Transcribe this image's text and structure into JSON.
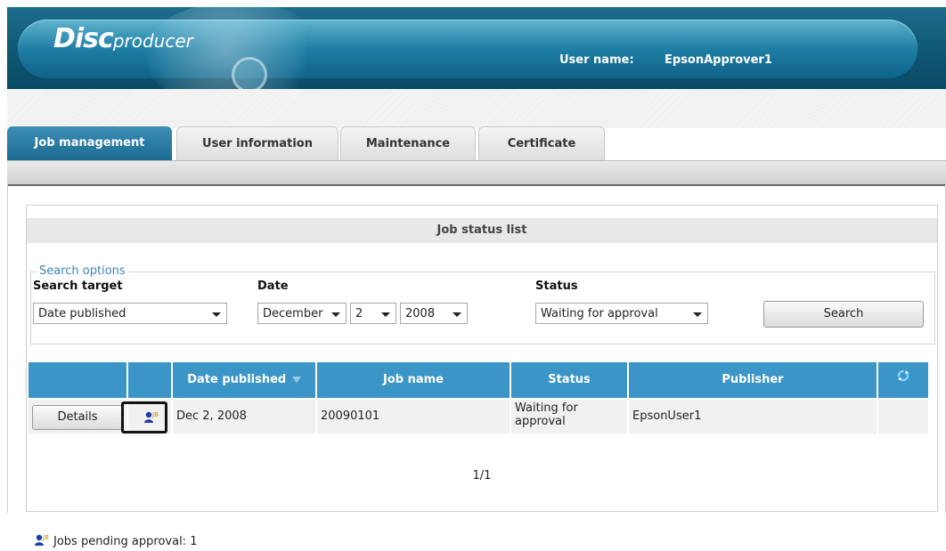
{
  "app": {
    "logo_bold": "Disc",
    "logo_rest": "producer",
    "user_label": "User name:",
    "user_name": "EpsonApprover1"
  },
  "tabs": [
    {
      "label": "Job management",
      "active": true
    },
    {
      "label": "User information",
      "active": false
    },
    {
      "label": "Maintenance",
      "active": false
    },
    {
      "label": "Certificate",
      "active": false
    }
  ],
  "job_list": {
    "title": "Job status list",
    "search": {
      "legend": "Search options",
      "target_label": "Search target",
      "target_value": "Date published",
      "date_label": "Date",
      "month": "December",
      "day": "2",
      "year": "2008",
      "status_label": "Status",
      "status_value": "Waiting for approval",
      "button": "Search"
    },
    "columns": [
      "",
      "",
      "Date published",
      "Job name",
      "Status",
      "Publisher",
      ""
    ],
    "rows": [
      {
        "button": "Details",
        "date": "Dec 2, 2008",
        "job_name": "20090101",
        "status": "Waiting for approval",
        "publisher": "EpsonUser1"
      }
    ],
    "pager": "1/1"
  },
  "footer": {
    "pending_label": "Jobs pending approval: 1"
  },
  "colors": {
    "accent": "#3c95c7",
    "header": "#0f5774",
    "legend": "#3a86b8"
  },
  "icons": {
    "sort": "sort-down-icon",
    "refresh": "refresh-icon",
    "approval": "job-approval-icon"
  }
}
